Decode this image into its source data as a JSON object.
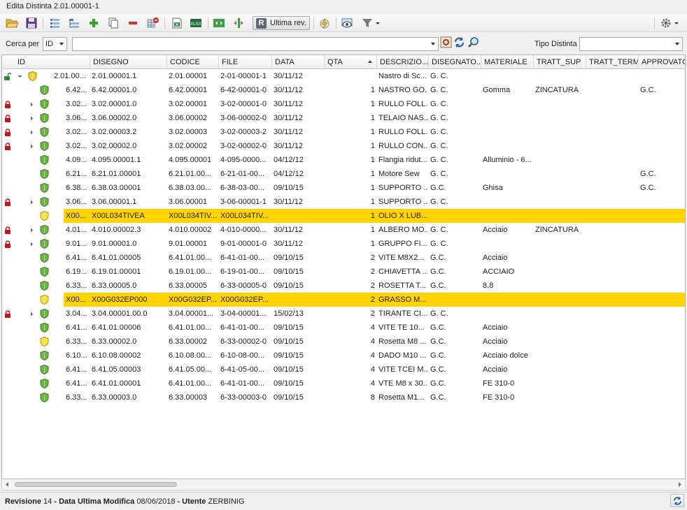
{
  "window_title": "Edita Distinta 2.01.00001-1",
  "toolbar": {
    "ultima_rev_label": "Ultima rev.",
    "r_glyph": "R",
    "icons": [
      "folder-open-icon",
      "save-icon",
      "list-icon",
      "list-tree-icon",
      "add-icon",
      "copy-icon",
      "remove-icon",
      "delete-grid-icon",
      "excel-icon",
      "xlsx-icon",
      "expand-icon",
      "collapse-icon",
      "ultima-rev-icon",
      "flash-icon",
      "preview-icon",
      "filter-icon",
      "gear-icon"
    ]
  },
  "search": {
    "cerca_label": "Cerca per",
    "cerca_value": "ID",
    "search_value": "",
    "tipo_label": "Tipo Distinta",
    "tipo_value": ""
  },
  "columns": [
    "ID",
    "DISEGNO",
    "CODICE",
    "FILE",
    "DATA",
    "QTA",
    "DESCRIZIO...",
    "DISEGNATO...",
    "MATERIALE",
    "TRATT_SUP",
    "TRATT_TERM",
    "APPROVATO"
  ],
  "rows": [
    {
      "lock": "unlock",
      "expander": "down",
      "shield": "gold",
      "id": "2.01.00...",
      "disegno": "2.01.00001.1",
      "codice": "2.01.00001",
      "file": "2-01-00001-1",
      "data": "30/11/12",
      "qta": "",
      "descr": "Nastro di Sc...",
      "disegnatore": "G. C.",
      "materiale": "",
      "tratt_sup": "",
      "tratt_term": "",
      "approvato": "",
      "hl": false,
      "indent": 0
    },
    {
      "lock": "",
      "expander": "",
      "shield": "green",
      "id": "6.42...",
      "disegno": "6.42.00001.0",
      "codice": "6.42.00001",
      "file": "6-42-00001-0",
      "data": "30/11/12",
      "qta": "1",
      "descr": "NASTRO GO...",
      "disegnatore": "G. C.",
      "materiale": "Gomma",
      "tratt_sup": "ZINCATURA",
      "tratt_term": "",
      "approvato": "G.C.",
      "hl": false,
      "indent": 1
    },
    {
      "lock": "lock",
      "expander": "right",
      "shield": "green",
      "id": "3.02...",
      "disegno": "3.02.00001.0",
      "codice": "3.02.00001",
      "file": "3-02-00001-0",
      "data": "30/11/12",
      "qta": "1",
      "descr": "RULLO FOLL...",
      "disegnatore": "G. C.",
      "materiale": "",
      "tratt_sup": "",
      "tratt_term": "",
      "approvato": "",
      "hl": false,
      "indent": 1
    },
    {
      "lock": "lock",
      "expander": "right",
      "shield": "green",
      "id": "3.06...",
      "disegno": "3.06.00002.0",
      "codice": "3.06.00002",
      "file": "3-06-00002-0",
      "data": "30/11/12",
      "qta": "1",
      "descr": "TELAIO NAS...",
      "disegnatore": "G. C.",
      "materiale": "",
      "tratt_sup": "",
      "tratt_term": "",
      "approvato": "",
      "hl": false,
      "indent": 1
    },
    {
      "lock": "lock",
      "expander": "right",
      "shield": "green",
      "id": "3.02...",
      "disegno": "3.02.00003.2",
      "codice": "3.02.00003",
      "file": "3-02-00003-2",
      "data": "30/11/12",
      "qta": "1",
      "descr": "RULLO FOLL...",
      "disegnatore": "G. C.",
      "materiale": "",
      "tratt_sup": "",
      "tratt_term": "",
      "approvato": "",
      "hl": false,
      "indent": 1
    },
    {
      "lock": "lock",
      "expander": "right",
      "shield": "green",
      "id": "3.02...",
      "disegno": "3.02.00002.0",
      "codice": "3.02.00002",
      "file": "3-02-00002-0",
      "data": "30/11/12",
      "qta": "1",
      "descr": "RULLO CON...",
      "disegnatore": "G. C.",
      "materiale": "",
      "tratt_sup": "",
      "tratt_term": "",
      "approvato": "",
      "hl": false,
      "indent": 1
    },
    {
      "lock": "",
      "expander": "",
      "shield": "green",
      "id": "4.09...",
      "disegno": "4.095.00001.1",
      "codice": "4.095.00001",
      "file": "4-095-0000...",
      "data": "04/12/12",
      "qta": "1",
      "descr": "Flangia ridut...",
      "disegnatore": "G. C.",
      "materiale": "Alluminio - 6...",
      "tratt_sup": "",
      "tratt_term": "",
      "approvato": "",
      "hl": false,
      "indent": 1
    },
    {
      "lock": "",
      "expander": "",
      "shield": "green",
      "id": "6.21...",
      "disegno": "6.21.01.00001",
      "codice": "6.21.01.00...",
      "file": "6-21-01-00...",
      "data": "04/12/12",
      "qta": "1",
      "descr": "Motore Sew",
      "disegnatore": "G. C.",
      "materiale": "",
      "tratt_sup": "",
      "tratt_term": "",
      "approvato": "G.C.",
      "hl": false,
      "indent": 1
    },
    {
      "lock": "",
      "expander": "",
      "shield": "green",
      "id": "6.38...",
      "disegno": "6.38.03.00001",
      "codice": "6.38.03.00...",
      "file": "6-38-03-00...",
      "data": "09/10/15",
      "qta": "1",
      "descr": "SUPPORTO ...",
      "disegnatore": "G.C.",
      "materiale": "Ghisa",
      "tratt_sup": "",
      "tratt_term": "",
      "approvato": "G.C.",
      "hl": false,
      "indent": 1
    },
    {
      "lock": "lock",
      "expander": "right",
      "shield": "green",
      "id": "3.06...",
      "disegno": "3.06.00001.1",
      "codice": "3.06.00001",
      "file": "3-06-00001-1",
      "data": "30/11/12",
      "qta": "1",
      "descr": "SUPPORTO ...",
      "disegnatore": "G. C.",
      "materiale": "",
      "tratt_sup": "",
      "tratt_term": "",
      "approvato": "",
      "hl": false,
      "indent": 1
    },
    {
      "lock": "",
      "expander": "",
      "shield": "yellow",
      "id": "X00...",
      "disegno": "X00L034TIVEA",
      "codice": "X00L034TIV...",
      "file": "X00L034TIV...",
      "data": "",
      "qta": "1",
      "descr": "OLIO X LUB...",
      "disegnatore": "",
      "materiale": "",
      "tratt_sup": "",
      "tratt_term": "",
      "approvato": "",
      "hl": true,
      "indent": 1
    },
    {
      "lock": "lock",
      "expander": "right",
      "shield": "green",
      "id": "4.01...",
      "disegno": "4.010.00002.3",
      "codice": "4.010.00002",
      "file": "4-010-0000...",
      "data": "30/11/12",
      "qta": "1",
      "descr": "ALBERO MO...",
      "disegnatore": "G. C.",
      "materiale": "Acciaio",
      "tratt_sup": "ZINCATURA",
      "tratt_term": "",
      "approvato": "",
      "hl": false,
      "indent": 1
    },
    {
      "lock": "lock",
      "expander": "right",
      "shield": "green",
      "id": "9.01...",
      "disegno": "9.01.00001.0",
      "codice": "9.01.00001",
      "file": "9-01-00001-0",
      "data": "30/11/12",
      "qta": "1",
      "descr": "GRUPPO FI...",
      "disegnatore": "G. C.",
      "materiale": "",
      "tratt_sup": "",
      "tratt_term": "",
      "approvato": "",
      "hl": false,
      "indent": 1
    },
    {
      "lock": "",
      "expander": "",
      "shield": "green",
      "id": "6.41...",
      "disegno": "6.41.01.00005",
      "codice": "6.41.01.00...",
      "file": "6-41-01-00...",
      "data": "09/10/15",
      "qta": "2",
      "descr": "VITE   M8X2...",
      "disegnatore": "G.C.",
      "materiale": "Acciaio",
      "tratt_sup": "",
      "tratt_term": "",
      "approvato": "",
      "hl": false,
      "indent": 1
    },
    {
      "lock": "",
      "expander": "",
      "shield": "green",
      "id": "6.19...",
      "disegno": "6.19.01.00001",
      "codice": "6.19.01.00...",
      "file": "6-19-01-00...",
      "data": "09/10/15",
      "qta": "2",
      "descr": "CHIAVETTA ...",
      "disegnatore": "G.C.",
      "materiale": "ACCIAIO",
      "tratt_sup": "",
      "tratt_term": "",
      "approvato": "",
      "hl": false,
      "indent": 1
    },
    {
      "lock": "",
      "expander": "",
      "shield": "green",
      "id": "6.33...",
      "disegno": "6.33.00005.0",
      "codice": "6.33.00005",
      "file": "6-33-00005-0",
      "data": "09/10/15",
      "qta": "2",
      "descr": "ROSETTA T...",
      "disegnatore": "G.C.",
      "materiale": "8.8",
      "tratt_sup": "",
      "tratt_term": "",
      "approvato": "",
      "hl": false,
      "indent": 1
    },
    {
      "lock": "",
      "expander": "",
      "shield": "yellow",
      "id": "X00...",
      "disegno": "X00G032EP000",
      "codice": "X00G032EP...",
      "file": "X00G032EP...",
      "data": "",
      "qta": "2",
      "descr": "GRASSO M...",
      "disegnatore": "",
      "materiale": "",
      "tratt_sup": "",
      "tratt_term": "",
      "approvato": "",
      "hl": true,
      "indent": 1
    },
    {
      "lock": "lock",
      "expander": "right",
      "shield": "green",
      "id": "3.04...",
      "disegno": "3.04.00001.00.0",
      "codice": "3.04.00001...",
      "file": "3-04-00001...",
      "data": "15/02/13",
      "qta": "2",
      "descr": "TIRANTE CI...",
      "disegnatore": "G. C.",
      "materiale": "",
      "tratt_sup": "",
      "tratt_term": "",
      "approvato": "",
      "hl": false,
      "indent": 1
    },
    {
      "lock": "",
      "expander": "",
      "shield": "green",
      "id": "6.41...",
      "disegno": "6.41.01.00006",
      "codice": "6.41.01.00...",
      "file": "6-41-01-00...",
      "data": "09/10/15",
      "qta": "4",
      "descr": "VITE TE   10...",
      "disegnatore": "G.C.",
      "materiale": "Acciaio",
      "tratt_sup": "",
      "tratt_term": "",
      "approvato": "",
      "hl": false,
      "indent": 1
    },
    {
      "lock": "",
      "expander": "",
      "shield": "yellow",
      "id": "6.33...",
      "disegno": "6.33.00002.0",
      "codice": "6.33.00002",
      "file": "6-33-00002-0",
      "data": "09/10/15",
      "qta": "4",
      "descr": "Rosetta M8 ...",
      "disegnatore": "G.C.",
      "materiale": "Acciaio",
      "tratt_sup": "",
      "tratt_term": "",
      "approvato": "",
      "hl": false,
      "indent": 1
    },
    {
      "lock": "",
      "expander": "",
      "shield": "green",
      "id": "6.10...",
      "disegno": "6.10.08.00002",
      "codice": "6.10.08.00...",
      "file": "6-10-08-00...",
      "data": "09/10/15",
      "qta": "4",
      "descr": "DADO M10 ...",
      "disegnatore": "G.C.",
      "materiale": "Acciaio dolce",
      "tratt_sup": "",
      "tratt_term": "",
      "approvato": "",
      "hl": false,
      "indent": 1
    },
    {
      "lock": "",
      "expander": "",
      "shield": "green",
      "id": "6.41...",
      "disegno": "6.41.05.00003",
      "codice": "6.41.05.00...",
      "file": "6-41-05-00...",
      "data": "09/10/15",
      "qta": "4",
      "descr": "VITE TCEI M...",
      "disegnatore": "G.C.",
      "materiale": "Acciaio",
      "tratt_sup": "",
      "tratt_term": "",
      "approvato": "",
      "hl": false,
      "indent": 1
    },
    {
      "lock": "",
      "expander": "",
      "shield": "green",
      "id": "6.41...",
      "disegno": "6.41.01.00001",
      "codice": "6.41.01.00...",
      "file": "6-41-01-00...",
      "data": "09/10/15",
      "qta": "4",
      "descr": "VTE M8 x 30...",
      "disegnatore": "G.C.",
      "materiale": "FE 310-0",
      "tratt_sup": "",
      "tratt_term": "",
      "approvato": "",
      "hl": false,
      "indent": 1
    },
    {
      "lock": "",
      "expander": "",
      "shield": "green",
      "id": "6.33...",
      "disegno": "6.33.00003.0",
      "codice": "6.33.00003",
      "file": "6-33-00003-0",
      "data": "09/10/15",
      "qta": "8",
      "descr": "Rosetta M1...",
      "disegnatore": "G.C.",
      "materiale": "FE 310-0",
      "tratt_sup": "",
      "tratt_term": "",
      "approvato": "",
      "hl": false,
      "indent": 1
    }
  ],
  "status": {
    "revisione_label": "Revisione",
    "revisione_value": "14",
    "sep1": " - ",
    "data_label": "Data Ultima Modifica",
    "data_value": "08/06/2018",
    "sep2": " - ",
    "utente_label": "Utente",
    "utente_value": "ZERBINIG"
  },
  "colors": {
    "highlight": "#ffd400",
    "lock_red": "#c0161c",
    "unlock_green": "#2e8b2e",
    "shield_green": "#5ca33a",
    "shield_gold": "#e3b800"
  }
}
